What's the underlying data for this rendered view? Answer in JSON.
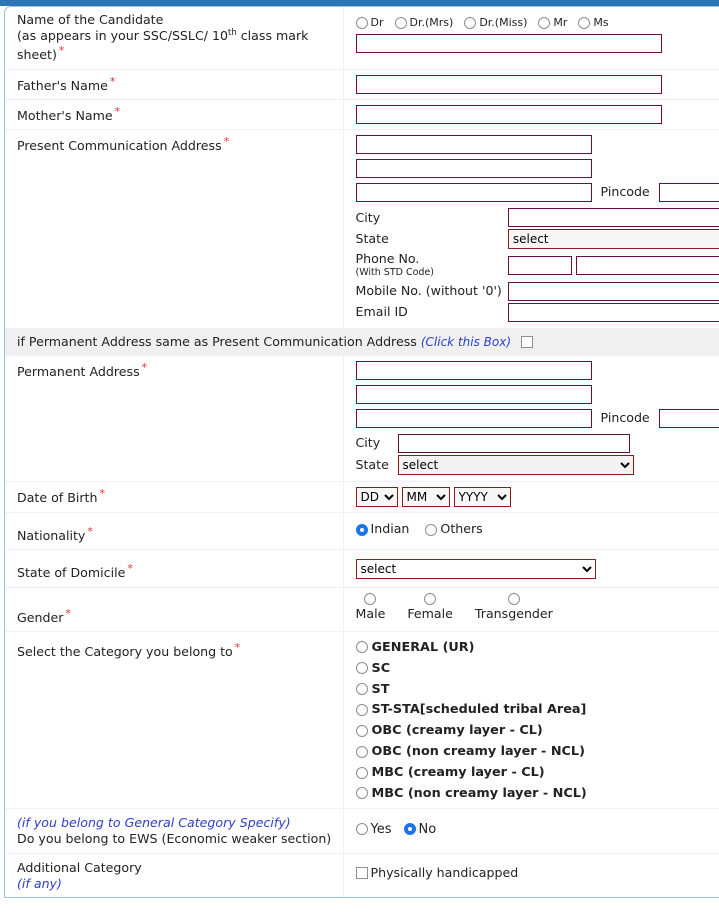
{
  "theme": {
    "accent": "#2e75b6",
    "input_border": "#6b0b47",
    "select_border": "#8b1a1a",
    "required_star": "#e03030",
    "italic_blue": "#2b3fc8"
  },
  "rows": {
    "candidate_name": {
      "label_line1": "Name of the Candidate",
      "label_line2a": "(as appears in your SSC/SSLC/ 10",
      "label_line2sup": "th",
      "label_line2b": " class mark",
      "label_line3": "sheet)",
      "required": "*",
      "titles": [
        {
          "label": "Dr",
          "selected": false
        },
        {
          "label": "Dr.(Mrs)",
          "selected": false
        },
        {
          "label": "Dr.(Miss)",
          "selected": false
        },
        {
          "label": "Mr",
          "selected": false
        },
        {
          "label": "Ms",
          "selected": false
        }
      ],
      "value": ""
    },
    "father_name": {
      "label": "Father's Name",
      "required": "*",
      "value": ""
    },
    "mother_name": {
      "label": "Mother's Name",
      "required": "*",
      "value": ""
    },
    "present_address": {
      "label": "Present Communication Address",
      "required": "*",
      "line1": "",
      "line2": "",
      "line3": "",
      "pincode_label": "Pincode",
      "pincode": "",
      "trailing_paren": "(",
      "city_label": "City",
      "city": "",
      "state_label": "State",
      "state_value": "select",
      "phone_label_l1": "Phone No.",
      "phone_label_l2": "(With STD Code)",
      "phone_std": "",
      "phone_number": "",
      "mobile_label": "Mobile No. (without '0')",
      "mobile": "",
      "email_label": "Email ID",
      "email": ""
    },
    "same_address": {
      "text": "if Permanent Address same as Present Communication Address",
      "hint": "(Click this Box)",
      "checked": false
    },
    "permanent_address": {
      "label": "Permanent Address",
      "required": "*",
      "line1": "",
      "line2": "",
      "line3": "",
      "pincode_label": "Pincode",
      "pincode": "",
      "trailing_paren": "(",
      "city_label": "City",
      "city": "",
      "state_label": "State",
      "state_value": "select"
    },
    "dob": {
      "label": "Date of Birth",
      "required": "*",
      "day": "DD",
      "month": "MM",
      "year": "YYYY"
    },
    "nationality": {
      "label": "Nationality",
      "required": "*",
      "options": [
        {
          "label": "Indian",
          "selected": true
        },
        {
          "label": "Others",
          "selected": false
        }
      ]
    },
    "domicile": {
      "label": "State of Domicile",
      "required": "*",
      "value": "select"
    },
    "gender": {
      "label": "Gender",
      "required": "*",
      "options": [
        {
          "label": "Male",
          "selected": false
        },
        {
          "label": "Female",
          "selected": false
        },
        {
          "label": "Transgender",
          "selected": false
        }
      ]
    },
    "category": {
      "label": "Select the Category you belong to",
      "required": "*",
      "options": [
        {
          "label": "GENERAL (UR)",
          "selected": false
        },
        {
          "label": "SC",
          "selected": false
        },
        {
          "label": "ST",
          "selected": false
        },
        {
          "label": "ST-STA[scheduled tribal Area]",
          "selected": false
        },
        {
          "label": "OBC (creamy layer - CL)",
          "selected": false
        },
        {
          "label": "OBC (non creamy layer - NCL)",
          "selected": false
        },
        {
          "label": "MBC (creamy layer - CL)",
          "selected": false
        },
        {
          "label": "MBC (non creamy layer - NCL)",
          "selected": false
        }
      ]
    },
    "ews": {
      "label_line1": "(if you belong to General Category Specify)",
      "label_line2": "Do you belong to EWS (Economic weaker section)",
      "options": [
        {
          "label": "Yes",
          "selected": false
        },
        {
          "label": "No",
          "selected": true
        }
      ]
    },
    "additional_category": {
      "label_line1": "Additional Category",
      "label_line2": "(if any)",
      "checkbox_label": "Physically handicapped",
      "checked": false
    }
  }
}
